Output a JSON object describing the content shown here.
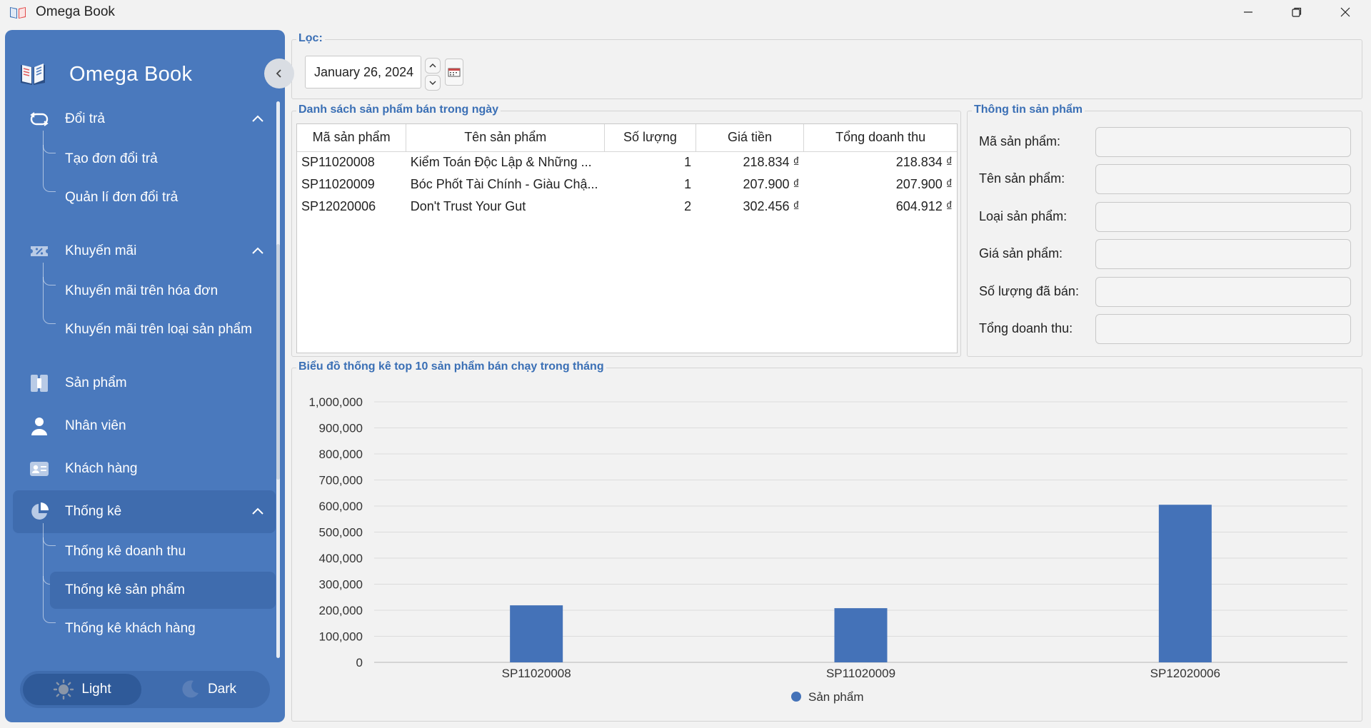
{
  "window": {
    "title": "Omega Book",
    "controls": [
      "minimize",
      "maximize",
      "close"
    ]
  },
  "sidebar": {
    "brand": "Omega Book",
    "groups": [
      {
        "label": "Đổi trả",
        "icon": "return-icon",
        "expanded": true,
        "items": [
          "Tạo đơn đổi trả",
          "Quản lí đơn đổi trả"
        ]
      },
      {
        "label": "Khuyến mãi",
        "icon": "discount-icon",
        "expanded": true,
        "items": [
          "Khuyến mãi trên hóa đơn",
          "Khuyến mãi trên loại sản phẩm"
        ]
      },
      {
        "label": "Sản phẩm",
        "icon": "product-icon"
      },
      {
        "label": "Nhân viên",
        "icon": "employee-icon"
      },
      {
        "label": "Khách hàng",
        "icon": "customer-card-icon"
      },
      {
        "label": "Thống kê",
        "icon": "pie-chart-icon",
        "expanded": true,
        "active": true,
        "items": [
          "Thống kê doanh thu",
          "Thống kê sản phẩm",
          "Thống kê khách hàng"
        ]
      }
    ],
    "active_item": "Thống kê sản phẩm",
    "theme": {
      "light": "Light",
      "dark": "Dark",
      "selected": "Light"
    }
  },
  "filter": {
    "legend": "Lọc:",
    "date_value": "January 26, 2024"
  },
  "product_list": {
    "legend": "Danh sách sản phẩm bán trong ngày",
    "columns": [
      "Mã sản phẩm",
      "Tên sản phẩm",
      "Số lượng",
      "Giá tiền",
      "Tổng doanh thu"
    ],
    "rows": [
      [
        "SP11020008",
        "Kiểm Toán Độc Lập & Những ...",
        "1",
        "218.834 ₫",
        "218.834 ₫"
      ],
      [
        "SP11020009",
        "Bóc Phốt Tài Chính - Giàu Chậ...",
        "1",
        "207.900 ₫",
        "207.900 ₫"
      ],
      [
        "SP12020006",
        "Don't Trust Your Gut",
        "2",
        "302.456 ₫",
        "604.912 ₫"
      ]
    ]
  },
  "product_info": {
    "legend": "Thông tin sản phẩm",
    "fields": [
      {
        "label": "Mã sản phẩm:",
        "value": ""
      },
      {
        "label": "Tên sản phẩm:",
        "value": ""
      },
      {
        "label": "Loại sản phẩm:",
        "value": ""
      },
      {
        "label": "Giá sản phẩm:",
        "value": ""
      },
      {
        "label": "Số lượng đã bán:",
        "value": ""
      },
      {
        "label": "Tổng doanh thu:",
        "value": ""
      }
    ]
  },
  "chart_section": {
    "legend": "Biểu đồ thống kê top 10 sản phẩm bán chạy trong tháng"
  },
  "chart_data": {
    "type": "bar",
    "categories": [
      "SP11020008",
      "SP11020009",
      "SP12020006"
    ],
    "series": [
      {
        "name": "Sản phẩm",
        "values": [
          218834,
          207900,
          604912
        ],
        "color": "#4472b8"
      }
    ],
    "ylim": [
      0,
      1000000
    ],
    "yticks": [
      "0",
      "100,000",
      "200,000",
      "300,000",
      "400,000",
      "500,000",
      "600,000",
      "700,000",
      "800,000",
      "900,000",
      "1,000,000"
    ],
    "grid": true,
    "legend_position": "bottom-center"
  },
  "colors": {
    "sidebar_bg": "#4a79bd",
    "sidebar_active": "#3f6cae",
    "accent_text": "#3a6fb5",
    "bar": "#4472b8"
  }
}
